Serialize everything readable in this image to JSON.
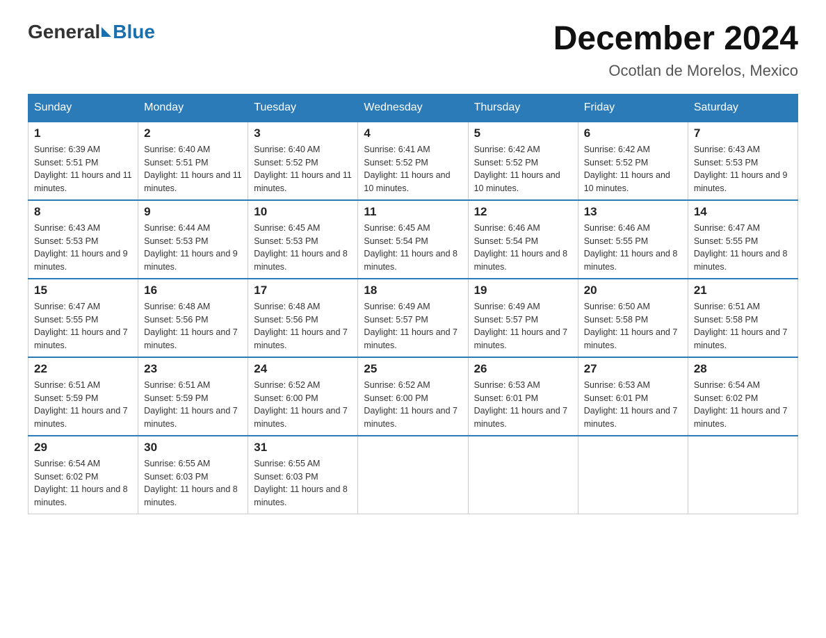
{
  "logo": {
    "general": "General",
    "blue": "Blue"
  },
  "title": "December 2024",
  "subtitle": "Ocotlan de Morelos, Mexico",
  "weekdays": [
    "Sunday",
    "Monday",
    "Tuesday",
    "Wednesday",
    "Thursday",
    "Friday",
    "Saturday"
  ],
  "weeks": [
    [
      {
        "day": "1",
        "sunrise": "6:39 AM",
        "sunset": "5:51 PM",
        "daylight": "11 hours and 11 minutes."
      },
      {
        "day": "2",
        "sunrise": "6:40 AM",
        "sunset": "5:51 PM",
        "daylight": "11 hours and 11 minutes."
      },
      {
        "day": "3",
        "sunrise": "6:40 AM",
        "sunset": "5:52 PM",
        "daylight": "11 hours and 11 minutes."
      },
      {
        "day": "4",
        "sunrise": "6:41 AM",
        "sunset": "5:52 PM",
        "daylight": "11 hours and 10 minutes."
      },
      {
        "day": "5",
        "sunrise": "6:42 AM",
        "sunset": "5:52 PM",
        "daylight": "11 hours and 10 minutes."
      },
      {
        "day": "6",
        "sunrise": "6:42 AM",
        "sunset": "5:52 PM",
        "daylight": "11 hours and 10 minutes."
      },
      {
        "day": "7",
        "sunrise": "6:43 AM",
        "sunset": "5:53 PM",
        "daylight": "11 hours and 9 minutes."
      }
    ],
    [
      {
        "day": "8",
        "sunrise": "6:43 AM",
        "sunset": "5:53 PM",
        "daylight": "11 hours and 9 minutes."
      },
      {
        "day": "9",
        "sunrise": "6:44 AM",
        "sunset": "5:53 PM",
        "daylight": "11 hours and 9 minutes."
      },
      {
        "day": "10",
        "sunrise": "6:45 AM",
        "sunset": "5:53 PM",
        "daylight": "11 hours and 8 minutes."
      },
      {
        "day": "11",
        "sunrise": "6:45 AM",
        "sunset": "5:54 PM",
        "daylight": "11 hours and 8 minutes."
      },
      {
        "day": "12",
        "sunrise": "6:46 AM",
        "sunset": "5:54 PM",
        "daylight": "11 hours and 8 minutes."
      },
      {
        "day": "13",
        "sunrise": "6:46 AM",
        "sunset": "5:55 PM",
        "daylight": "11 hours and 8 minutes."
      },
      {
        "day": "14",
        "sunrise": "6:47 AM",
        "sunset": "5:55 PM",
        "daylight": "11 hours and 8 minutes."
      }
    ],
    [
      {
        "day": "15",
        "sunrise": "6:47 AM",
        "sunset": "5:55 PM",
        "daylight": "11 hours and 7 minutes."
      },
      {
        "day": "16",
        "sunrise": "6:48 AM",
        "sunset": "5:56 PM",
        "daylight": "11 hours and 7 minutes."
      },
      {
        "day": "17",
        "sunrise": "6:48 AM",
        "sunset": "5:56 PM",
        "daylight": "11 hours and 7 minutes."
      },
      {
        "day": "18",
        "sunrise": "6:49 AM",
        "sunset": "5:57 PM",
        "daylight": "11 hours and 7 minutes."
      },
      {
        "day": "19",
        "sunrise": "6:49 AM",
        "sunset": "5:57 PM",
        "daylight": "11 hours and 7 minutes."
      },
      {
        "day": "20",
        "sunrise": "6:50 AM",
        "sunset": "5:58 PM",
        "daylight": "11 hours and 7 minutes."
      },
      {
        "day": "21",
        "sunrise": "6:51 AM",
        "sunset": "5:58 PM",
        "daylight": "11 hours and 7 minutes."
      }
    ],
    [
      {
        "day": "22",
        "sunrise": "6:51 AM",
        "sunset": "5:59 PM",
        "daylight": "11 hours and 7 minutes."
      },
      {
        "day": "23",
        "sunrise": "6:51 AM",
        "sunset": "5:59 PM",
        "daylight": "11 hours and 7 minutes."
      },
      {
        "day": "24",
        "sunrise": "6:52 AM",
        "sunset": "6:00 PM",
        "daylight": "11 hours and 7 minutes."
      },
      {
        "day": "25",
        "sunrise": "6:52 AM",
        "sunset": "6:00 PM",
        "daylight": "11 hours and 7 minutes."
      },
      {
        "day": "26",
        "sunrise": "6:53 AM",
        "sunset": "6:01 PM",
        "daylight": "11 hours and 7 minutes."
      },
      {
        "day": "27",
        "sunrise": "6:53 AM",
        "sunset": "6:01 PM",
        "daylight": "11 hours and 7 minutes."
      },
      {
        "day": "28",
        "sunrise": "6:54 AM",
        "sunset": "6:02 PM",
        "daylight": "11 hours and 7 minutes."
      }
    ],
    [
      {
        "day": "29",
        "sunrise": "6:54 AM",
        "sunset": "6:02 PM",
        "daylight": "11 hours and 8 minutes."
      },
      {
        "day": "30",
        "sunrise": "6:55 AM",
        "sunset": "6:03 PM",
        "daylight": "11 hours and 8 minutes."
      },
      {
        "day": "31",
        "sunrise": "6:55 AM",
        "sunset": "6:03 PM",
        "daylight": "11 hours and 8 minutes."
      },
      null,
      null,
      null,
      null
    ]
  ]
}
